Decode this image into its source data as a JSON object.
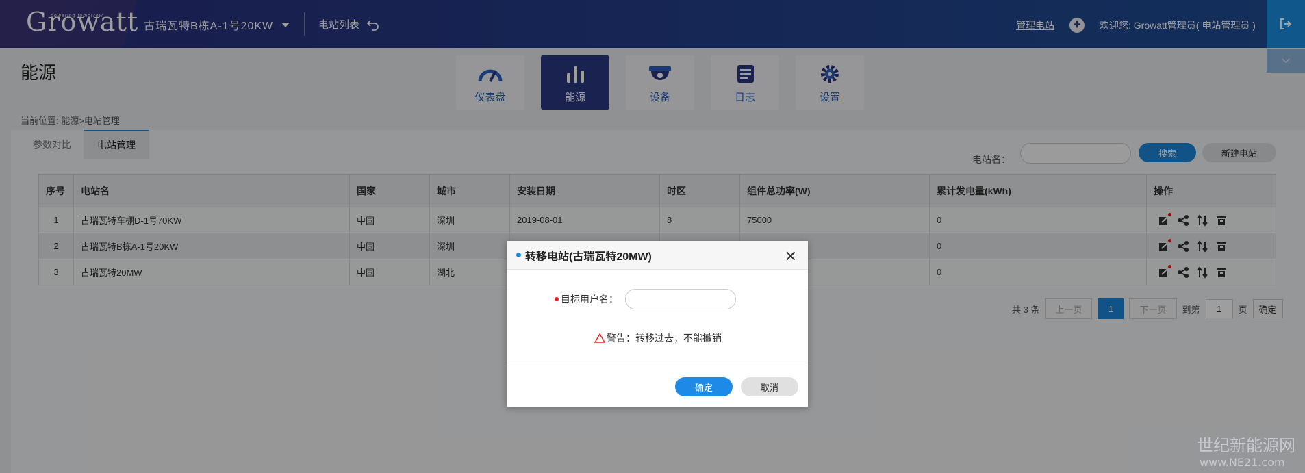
{
  "header": {
    "logo": "Growatt",
    "logo_tag": "powering tomorrow",
    "plant_select": "古瑞瓦特B栋A-1号20KW",
    "plant_list": "电站列表",
    "manage_plant": "管理电站",
    "welcome": "欢迎您: Growatt管理员( 电站管理员 )"
  },
  "page": {
    "title": "能源",
    "breadcrumb": "当前位置: 能源>电站管理"
  },
  "nav": [
    {
      "label": "仪表盘",
      "icon": "gauge-icon"
    },
    {
      "label": "能源",
      "icon": "bar-chart-icon",
      "active": true
    },
    {
      "label": "设备",
      "icon": "device-icon"
    },
    {
      "label": "日志",
      "icon": "log-icon"
    },
    {
      "label": "设置",
      "icon": "gear-icon"
    }
  ],
  "tabs": [
    {
      "label": "参数对比"
    },
    {
      "label": "电站管理",
      "active": true
    }
  ],
  "search": {
    "label": "电站名：",
    "button": "搜索",
    "new_button": "新建电站"
  },
  "table": {
    "columns": [
      "序号",
      "电站名",
      "国家",
      "城市",
      "安装日期",
      "时区",
      "组件总功率(W)",
      "累计发电量(kWh)",
      "操作"
    ],
    "rows": [
      [
        "1",
        "古瑞瓦特车棚D-1号70KW",
        "中国",
        "深圳",
        "2019-08-01",
        "8",
        "75000",
        "0"
      ],
      [
        "2",
        "古瑞瓦特B栋A-1号20KW",
        "中国",
        "深圳",
        "",
        "",
        "",
        "0"
      ],
      [
        "3",
        "古瑞瓦特20MW",
        "中国",
        "湖北",
        "",
        "",
        "",
        "0"
      ]
    ]
  },
  "pagination": {
    "total": "共 3 条",
    "prev": "上一页",
    "current": "1",
    "next": "下一页",
    "goto": "到第",
    "page_value": "1",
    "page_unit": "页",
    "confirm": "确定"
  },
  "modal": {
    "title": "转移电站(古瑞瓦特20MW)",
    "field_label": "目标用户名：",
    "warning": "警告：转移过去，不能撤销",
    "ok": "确定",
    "cancel": "取消"
  },
  "watermark": {
    "line1": "世纪新能源网",
    "line2": "www.NE21.com"
  }
}
